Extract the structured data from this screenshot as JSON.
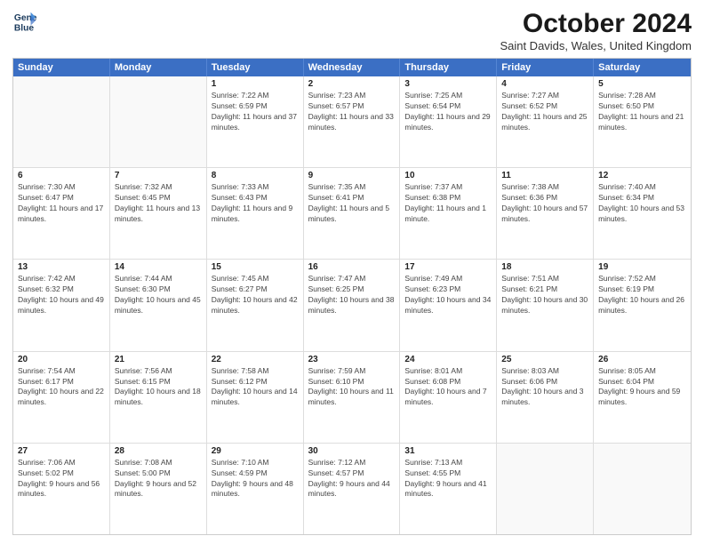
{
  "header": {
    "logo_line1": "General",
    "logo_line2": "Blue",
    "title": "October 2024",
    "subtitle": "Saint Davids, Wales, United Kingdom"
  },
  "weekdays": [
    "Sunday",
    "Monday",
    "Tuesday",
    "Wednesday",
    "Thursday",
    "Friday",
    "Saturday"
  ],
  "weeks": [
    [
      {
        "day": "",
        "empty": true
      },
      {
        "day": "",
        "empty": true
      },
      {
        "day": "1",
        "sunrise": "7:22 AM",
        "sunset": "6:59 PM",
        "daylight": "11 hours and 37 minutes."
      },
      {
        "day": "2",
        "sunrise": "7:23 AM",
        "sunset": "6:57 PM",
        "daylight": "11 hours and 33 minutes."
      },
      {
        "day": "3",
        "sunrise": "7:25 AM",
        "sunset": "6:54 PM",
        "daylight": "11 hours and 29 minutes."
      },
      {
        "day": "4",
        "sunrise": "7:27 AM",
        "sunset": "6:52 PM",
        "daylight": "11 hours and 25 minutes."
      },
      {
        "day": "5",
        "sunrise": "7:28 AM",
        "sunset": "6:50 PM",
        "daylight": "11 hours and 21 minutes."
      }
    ],
    [
      {
        "day": "6",
        "sunrise": "7:30 AM",
        "sunset": "6:47 PM",
        "daylight": "11 hours and 17 minutes."
      },
      {
        "day": "7",
        "sunrise": "7:32 AM",
        "sunset": "6:45 PM",
        "daylight": "11 hours and 13 minutes."
      },
      {
        "day": "8",
        "sunrise": "7:33 AM",
        "sunset": "6:43 PM",
        "daylight": "11 hours and 9 minutes."
      },
      {
        "day": "9",
        "sunrise": "7:35 AM",
        "sunset": "6:41 PM",
        "daylight": "11 hours and 5 minutes."
      },
      {
        "day": "10",
        "sunrise": "7:37 AM",
        "sunset": "6:38 PM",
        "daylight": "11 hours and 1 minute."
      },
      {
        "day": "11",
        "sunrise": "7:38 AM",
        "sunset": "6:36 PM",
        "daylight": "10 hours and 57 minutes."
      },
      {
        "day": "12",
        "sunrise": "7:40 AM",
        "sunset": "6:34 PM",
        "daylight": "10 hours and 53 minutes."
      }
    ],
    [
      {
        "day": "13",
        "sunrise": "7:42 AM",
        "sunset": "6:32 PM",
        "daylight": "10 hours and 49 minutes."
      },
      {
        "day": "14",
        "sunrise": "7:44 AM",
        "sunset": "6:30 PM",
        "daylight": "10 hours and 45 minutes."
      },
      {
        "day": "15",
        "sunrise": "7:45 AM",
        "sunset": "6:27 PM",
        "daylight": "10 hours and 42 minutes."
      },
      {
        "day": "16",
        "sunrise": "7:47 AM",
        "sunset": "6:25 PM",
        "daylight": "10 hours and 38 minutes."
      },
      {
        "day": "17",
        "sunrise": "7:49 AM",
        "sunset": "6:23 PM",
        "daylight": "10 hours and 34 minutes."
      },
      {
        "day": "18",
        "sunrise": "7:51 AM",
        "sunset": "6:21 PM",
        "daylight": "10 hours and 30 minutes."
      },
      {
        "day": "19",
        "sunrise": "7:52 AM",
        "sunset": "6:19 PM",
        "daylight": "10 hours and 26 minutes."
      }
    ],
    [
      {
        "day": "20",
        "sunrise": "7:54 AM",
        "sunset": "6:17 PM",
        "daylight": "10 hours and 22 minutes."
      },
      {
        "day": "21",
        "sunrise": "7:56 AM",
        "sunset": "6:15 PM",
        "daylight": "10 hours and 18 minutes."
      },
      {
        "day": "22",
        "sunrise": "7:58 AM",
        "sunset": "6:12 PM",
        "daylight": "10 hours and 14 minutes."
      },
      {
        "day": "23",
        "sunrise": "7:59 AM",
        "sunset": "6:10 PM",
        "daylight": "10 hours and 11 minutes."
      },
      {
        "day": "24",
        "sunrise": "8:01 AM",
        "sunset": "6:08 PM",
        "daylight": "10 hours and 7 minutes."
      },
      {
        "day": "25",
        "sunrise": "8:03 AM",
        "sunset": "6:06 PM",
        "daylight": "10 hours and 3 minutes."
      },
      {
        "day": "26",
        "sunrise": "8:05 AM",
        "sunset": "6:04 PM",
        "daylight": "9 hours and 59 minutes."
      }
    ],
    [
      {
        "day": "27",
        "sunrise": "7:06 AM",
        "sunset": "5:02 PM",
        "daylight": "9 hours and 56 minutes."
      },
      {
        "day": "28",
        "sunrise": "7:08 AM",
        "sunset": "5:00 PM",
        "daylight": "9 hours and 52 minutes."
      },
      {
        "day": "29",
        "sunrise": "7:10 AM",
        "sunset": "4:59 PM",
        "daylight": "9 hours and 48 minutes."
      },
      {
        "day": "30",
        "sunrise": "7:12 AM",
        "sunset": "4:57 PM",
        "daylight": "9 hours and 44 minutes."
      },
      {
        "day": "31",
        "sunrise": "7:13 AM",
        "sunset": "4:55 PM",
        "daylight": "9 hours and 41 minutes."
      },
      {
        "day": "",
        "empty": true
      },
      {
        "day": "",
        "empty": true
      }
    ]
  ]
}
